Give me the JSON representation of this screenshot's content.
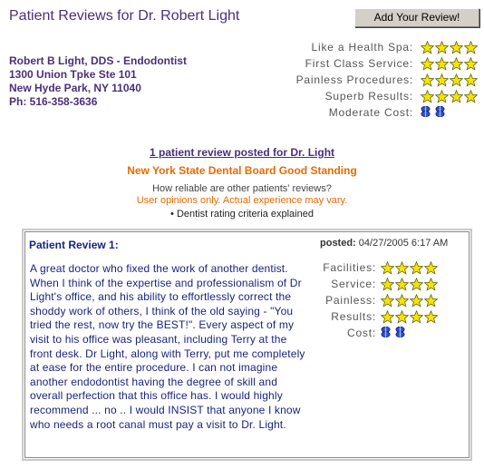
{
  "header": {
    "title": "Patient Reviews for Dr. Robert Light",
    "add_review_label": "Add Your Review!"
  },
  "dentist": {
    "name": "Robert B Light, DDS - Endodontist",
    "address1": "1300 Union Tpke Ste 101",
    "address2": "New Hyde Park, NY  11040",
    "phone": "Ph: 516-358-3636"
  },
  "summary_ratings": [
    {
      "label": "Like a Health Spa:",
      "icon": "star-icon",
      "count": 4
    },
    {
      "label": "First Class Service:",
      "icon": "star-icon",
      "count": 4
    },
    {
      "label": "Painless Procedures:",
      "icon": "star-icon",
      "count": 4
    },
    {
      "label": "Superb Results:",
      "icon": "star-icon",
      "count": 4
    },
    {
      "label": "Moderate Cost:",
      "icon": "dollar-icon",
      "count": 2
    }
  ],
  "info": {
    "review_count_link": "1 patient review posted for Dr. Light",
    "board_standing": "New York State Dental Board Good Standing",
    "reliable_question": "How reliable are other patients' reviews?",
    "disclaimer": "User opinions only. Actual experience may vary.",
    "criteria_link": "• Dentist rating criteria explained"
  },
  "review": {
    "title": "Patient Review 1:",
    "posted_label": "posted:",
    "posted_date": "04/27/2005 6:17 AM",
    "text": "A great doctor who fixed the work of another dentist. When I think of the expertise and professionalism of Dr Light's office, and his ability to effortlessly correct the shoddy work of others, I think of the old saying - \"You tried the rest, now try the BEST!\". Every aspect of my visit to his office was pleasant, including Terry at the front desk. Dr Light, along with Terry, put me completely at ease for the entire procedure. I can not imagine another endodontist having the degree of skill and overall perfection that this office has. I would highly recommend ... no .. I would INSIST that anyone I know who needs a root canal must pay a visit to Dr. Light.",
    "ratings": [
      {
        "label": "Facilities:",
        "icon": "star-icon",
        "count": 4
      },
      {
        "label": "Service:",
        "icon": "star-icon",
        "count": 4
      },
      {
        "label": "Painless:",
        "icon": "star-icon",
        "count": 4
      },
      {
        "label": "Results:",
        "icon": "star-icon",
        "count": 4
      },
      {
        "label": "Cost:",
        "icon": "dollar-icon",
        "count": 2
      }
    ]
  },
  "colors": {
    "title_purple": "#4b2f7a",
    "review_navy": "#1a237e",
    "orange": "#e86a00",
    "star_fill": "#f5e400",
    "cost_blue": "#2e4fc8"
  }
}
